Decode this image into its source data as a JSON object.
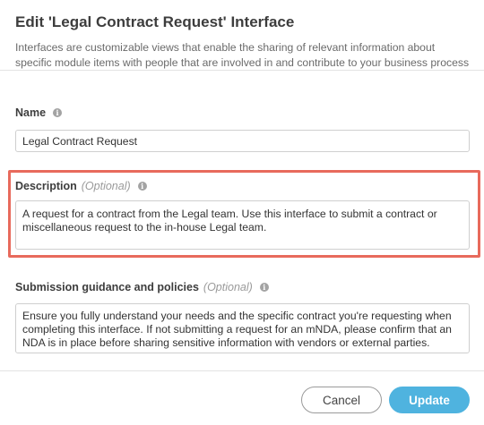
{
  "dialog": {
    "title": "Edit 'Legal Contract Request' Interface",
    "subtitle_line1": "Interfaces are customizable views that enable the sharing of relevant information about",
    "subtitle_line2": "specific module items with people that are involved in and contribute to your business process"
  },
  "name_field": {
    "label": "Name",
    "info_icon": "info-icon",
    "value": "Legal Contract Request"
  },
  "description_field": {
    "label": "Description",
    "optional": "(Optional)",
    "info_icon": "info-icon",
    "value_line1": "A request for a contract from the Legal team. Use this interface to submit a contract or",
    "value_line2": "miscellaneous request to the in-house Legal team.",
    "highlight_color": "#e86a5c"
  },
  "guidance_field": {
    "label": "Submission guidance and policies",
    "optional": "(Optional)",
    "info_icon": "info-icon",
    "value_line1": "Ensure you fully understand your needs and the specific contract you're requesting when",
    "value_line2": "completing this interface. If not submitting a request for an mNDA, please confirm that an",
    "value_line3": "NDA is in place before sharing sensitive information with vendors or external parties."
  },
  "footer": {
    "cancel_label": "Cancel",
    "update_label": "Update",
    "accent_color": "#4fb3df"
  }
}
